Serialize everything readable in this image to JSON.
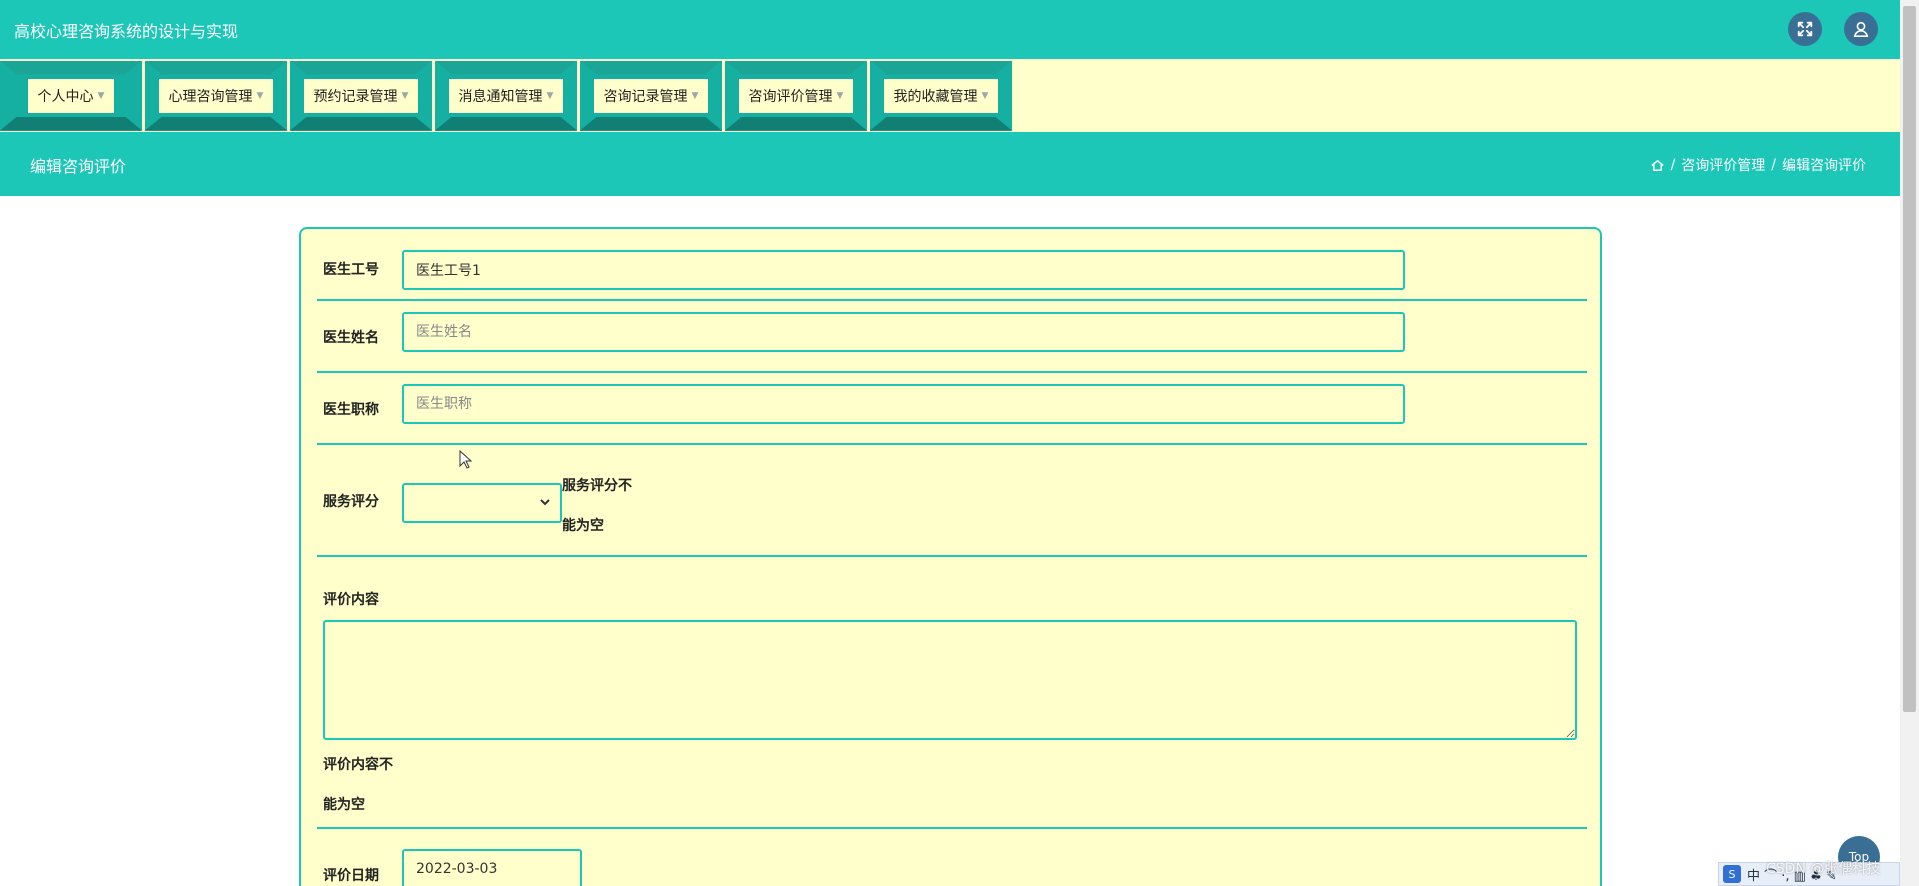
{
  "header": {
    "app_title": "高校心理咨询系统的设计与实现"
  },
  "nav": {
    "items": [
      {
        "label": "个人中心"
      },
      {
        "label": "心理咨询管理"
      },
      {
        "label": "预约记录管理"
      },
      {
        "label": "消息通知管理"
      },
      {
        "label": "咨询记录管理"
      },
      {
        "label": "咨询评价管理"
      },
      {
        "label": "我的收藏管理"
      }
    ]
  },
  "subheader": {
    "page_title": "编辑咨询评价",
    "breadcrumb": {
      "section": "咨询评价管理",
      "separator": "/",
      "current": "编辑咨询评价"
    }
  },
  "form": {
    "doctor_id": {
      "label": "医生工号",
      "value": "医生工号1"
    },
    "doctor_name": {
      "label": "医生姓名",
      "placeholder": "医生姓名"
    },
    "doctor_title": {
      "label": "医生职称",
      "placeholder": "医生职称"
    },
    "service_rating": {
      "label": "服务评分",
      "error_line1": "服务评分不",
      "error_line2": "能为空"
    },
    "review_content": {
      "label": "评价内容",
      "error_line1": "评价内容不",
      "error_line2": "能为空"
    },
    "review_date": {
      "label": "评价日期",
      "value": "2022-03-03"
    }
  },
  "floating": {
    "top_button": "Top",
    "ime_logo": "S",
    "ime_text": "中 ⌒ ·, ▥ ♣ ✎",
    "watermark": "CSDN @张偶科技"
  },
  "colors": {
    "accent": "#1cc7b8",
    "panel": "#ffffcc",
    "nav_dark": "#16b0a2",
    "icon_btn": "#3a6f95"
  }
}
